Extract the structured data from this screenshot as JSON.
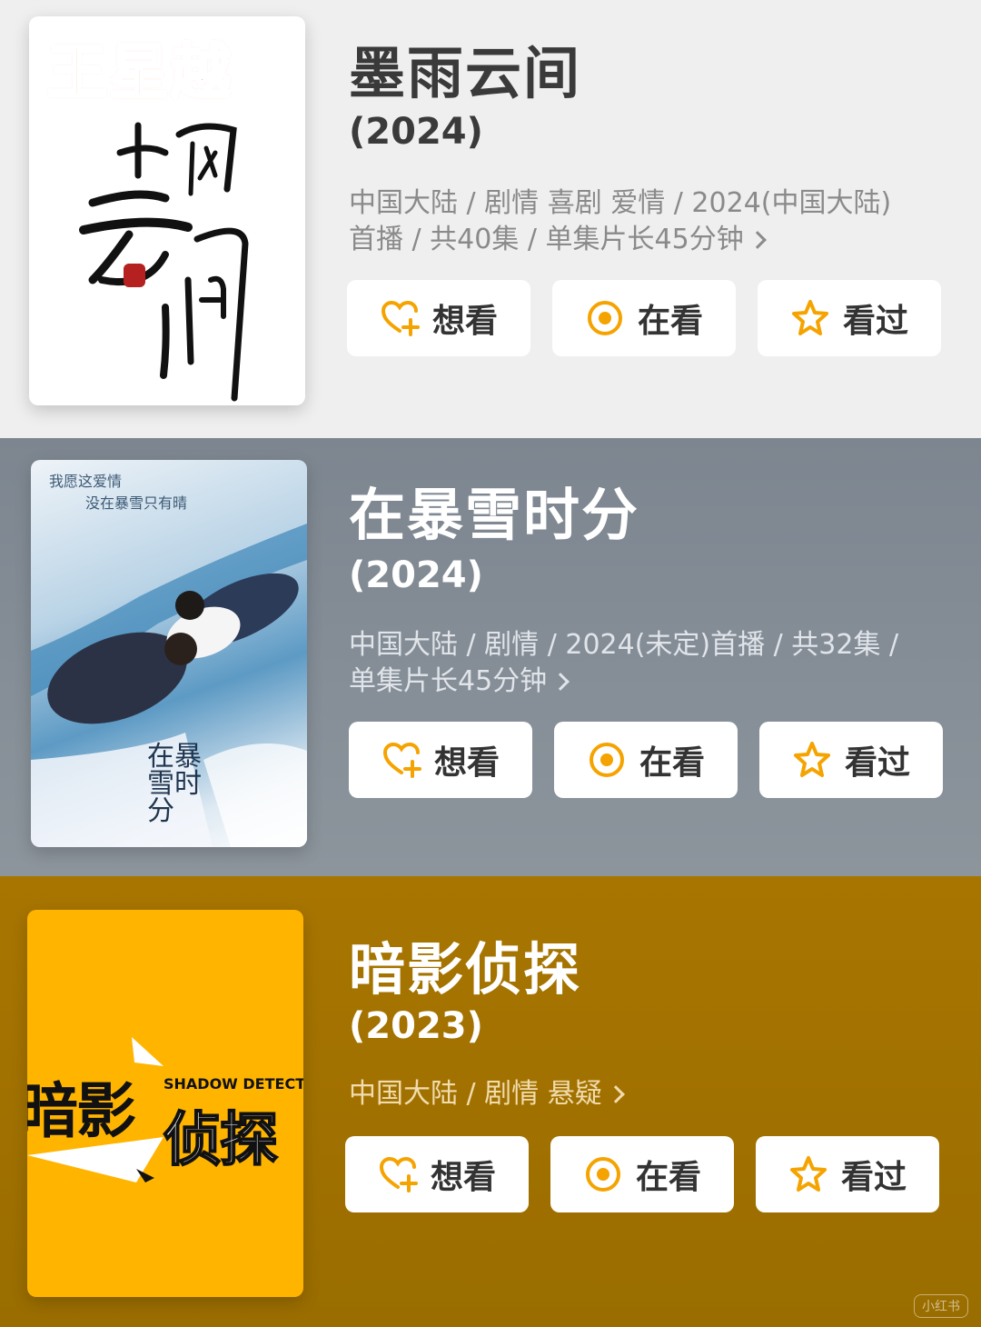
{
  "items": [
    {
      "title": "墨雨云间",
      "year": "(2024)",
      "meta": "中国大陆 / 剧情 喜剧 爱情 / 2024(中国大陆)首播 / 共40集 / 单集片长45分钟",
      "poster": {
        "overlay_text": "王星越",
        "calligraphy": [
          "墨",
          "雨",
          "云",
          "间"
        ],
        "bg": "#ffffff",
        "overlay_color": "#ff5a1f"
      }
    },
    {
      "title": "在暴雪时分",
      "year": "(2024)",
      "meta": "中国大陆 / 剧情 / 2024(未定)首播 / 共32集 / 单集片长45分钟",
      "poster": {
        "tagline_1": "我愿这爱情",
        "tagline_2": "没在暴雪只有晴",
        "logo": "在暴雪时分"
      }
    },
    {
      "title": "暗影侦探",
      "year": "(2023)",
      "meta": "中国大陆 / 剧情 悬疑",
      "poster": {
        "title_left": "暗影",
        "title_right": "侦探",
        "subtitle_en": "SHADOW DETECTIVE"
      }
    }
  ],
  "buttons": {
    "want": "想看",
    "watching": "在看",
    "watched": "看过"
  },
  "icons": {
    "want": "heart-plus-icon",
    "watching": "target-circle-icon",
    "watched": "star-outline-icon",
    "more": "chevron-right-icon"
  },
  "colors": {
    "accent": "#f5a300",
    "section1_bg": "#efefef",
    "section2_bg": "#858d96",
    "section3_bg": "#a37200"
  },
  "watermark": "小红书"
}
